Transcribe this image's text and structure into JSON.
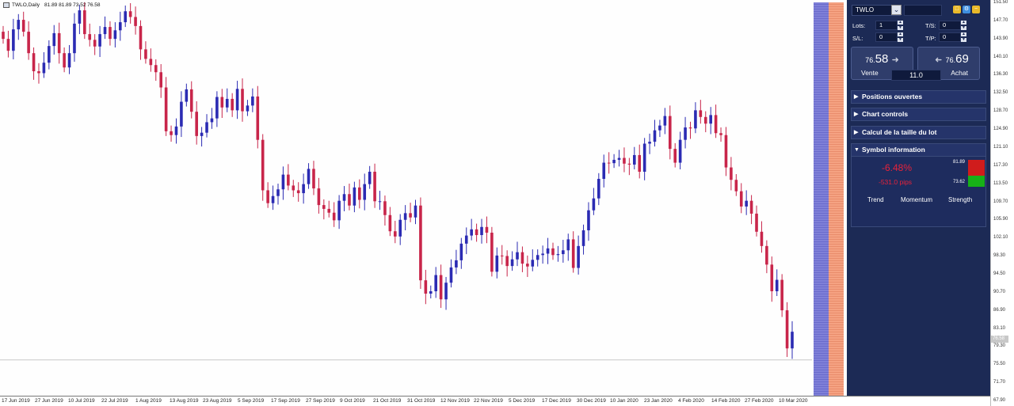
{
  "chart": {
    "symbol_period": "TWLO,Daily",
    "ohlc_header": "81.89 81.89 73.52 76.58",
    "current_price_label": "76.58",
    "up_color": "#2b2bb3",
    "down_color": "#c8254a",
    "price_ticks": [
      "151.50",
      "147.70",
      "143.90",
      "140.10",
      "136.30",
      "132.50",
      "128.70",
      "124.90",
      "121.10",
      "117.30",
      "113.50",
      "109.70",
      "105.90",
      "102.10",
      "98.30",
      "94.50",
      "90.70",
      "86.90",
      "83.10",
      "79.30",
      "75.50",
      "71.70",
      "67.90"
    ],
    "time_ticks": [
      "17 Jun 2019",
      "27 Jun 2019",
      "10 Jul 2019",
      "22 Jul 2019",
      "1 Aug 2019",
      "13 Aug 2019",
      "23 Aug 2019",
      "5 Sep 2019",
      "17 Sep 2019",
      "27 Sep 2019",
      "9 Oct 2019",
      "21 Oct 2019",
      "31 Oct 2019",
      "12 Nov 2019",
      "22 Nov 2019",
      "5 Dec 2019",
      "17 Dec 2019",
      "30 Dec 2019",
      "10 Jan 2020",
      "23 Jan 2020",
      "4 Feb 2020",
      "14 Feb 2020",
      "27 Feb 2020",
      "10 Mar 2020"
    ]
  },
  "chart_data": {
    "type": "candlestick",
    "ylim": [
      67.9,
      151.5
    ],
    "closes": [
      144.0,
      141.5,
      146.0,
      148.0,
      145.5,
      141.0,
      137.2,
      136.8,
      139.0,
      142.5,
      145.2,
      141.0,
      138.0,
      141.0,
      147.2,
      150.0,
      145.0,
      143.8,
      142.4,
      145.0,
      146.5,
      144.0,
      145.8,
      147.5,
      149.8,
      148.6,
      146.7,
      141.8,
      139.8,
      138.5,
      137.0,
      133.8,
      124.6,
      123.8,
      125.6,
      130.8,
      133.4,
      128.7,
      123.6,
      124.3,
      126.5,
      127.3,
      131.8,
      129.6,
      131.4,
      129.0,
      133.5,
      128.8,
      130.0,
      131.9,
      122.8,
      112.2,
      109.5,
      111.0,
      112.4,
      115.5,
      113.2,
      112.2,
      111.6,
      113.5,
      116.7,
      112.6,
      109.1,
      108.3,
      107.5,
      105.9,
      110.0,
      111.4,
      109.0,
      112.8,
      110.2,
      113.5,
      116.1,
      109.9,
      109.9,
      107.0,
      103.6,
      102.5,
      106.0,
      107.4,
      106.5,
      109.0,
      93.3,
      90.5,
      91.0,
      94.4,
      89.3,
      92.8,
      96.0,
      97.5,
      101.0,
      102.7,
      104.0,
      102.8,
      104.5,
      103.3,
      95.1,
      98.5,
      98.4,
      96.3,
      97.7,
      99.2,
      96.8,
      96.2,
      97.6,
      98.6,
      98.9,
      100.0,
      98.6,
      98.8,
      99.6,
      101.9,
      95.9,
      100.5,
      103.8,
      108.0,
      110.5,
      114.6,
      118.0,
      117.9,
      118.6,
      119.0,
      117.8,
      117.6,
      119.6,
      116.1,
      122.0,
      122.4,
      124.8,
      125.8,
      127.8,
      120.9,
      118.0,
      122.8,
      125.4,
      125.2,
      129.0,
      127.6,
      126.2,
      128.0,
      124.2,
      123.8,
      117.0,
      114.4,
      112.0,
      108.8,
      110.0,
      107.3,
      103.5,
      100.5,
      96.6,
      91.0,
      93.4,
      87.0,
      79.0,
      82.5
    ]
  },
  "panel": {
    "symbol": "TWLO",
    "lots_label": "Lots:",
    "lots_value": "1",
    "ts_label": "T/S:",
    "ts_value": "0",
    "sl_label": "S/L:",
    "sl_value": "0",
    "tp_label": "T/P:",
    "tp_value": "0",
    "sell_price_small": "76.",
    "sell_price_big": "58",
    "sell_label": "Vente",
    "buy_price_small": "76.",
    "buy_price_big": "69",
    "buy_label": "Achat",
    "spread": "11.0",
    "sections": [
      "Positions ouvertes",
      "Chart controls",
      "Calcul de la taille du lot",
      "Symbol information"
    ],
    "change_percent": "-6.48%",
    "change_pips": "-531.0 pips",
    "high": "81.89",
    "low": "73.62",
    "indicator_labels": [
      "Trend",
      "Momentum",
      "Strength"
    ],
    "colors": {
      "panel_bg": "#1c2a55",
      "change_red": "#e8223a",
      "swatch_red": "#d01c1c",
      "swatch_green": "#17b117"
    }
  }
}
